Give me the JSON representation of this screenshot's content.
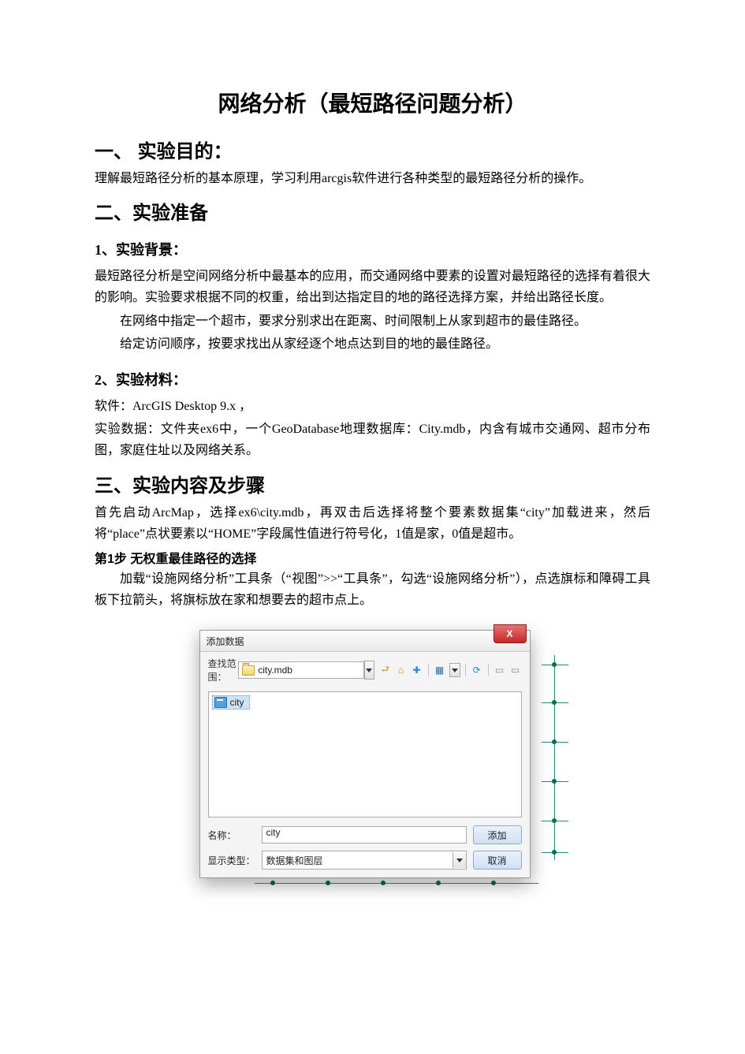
{
  "title": "网络分析（最短路径问题分析）",
  "sec1": {
    "heading": "一、 实验目的：",
    "p1": "理解最短路径分析的基本原理，学习利用arcgis软件进行各种类型的最短路径分析的操作。"
  },
  "sec2": {
    "heading": "二、实验准备",
    "sub1": {
      "heading": "1、实验背景：",
      "p1": "最短路径分析是空间网络分析中最基本的应用，而交通网络中要素的设置对最短路径的选择有着很大的影响。实验要求根据不同的权重，给出到达指定目的地的路径选择方案，并给出路径长度。",
      "p2": "在网络中指定一个超市，要求分别求出在距离、时间限制上从家到超市的最佳路径。",
      "p3": "给定访问顺序，按要求找出从家经逐个地点达到目的地的最佳路径。"
    },
    "sub2": {
      "heading": "2、实验材料：",
      "p1": "软件：ArcGIS Desktop 9.x ，",
      "p2": "实验数据：文件夹ex6中，一个GeoDatabase地理数据库：City.mdb，内含有城市交通网、超市分布图，家庭住址以及网络关系。"
    }
  },
  "sec3": {
    "heading": "三、实验内容及步骤",
    "p1": "首先启动ArcMap，选择ex6\\city.mdb，再双击后选择将整个要素数据集“city”加载进来，然后将“place”点状要素以“HOME”字段属性值进行符号化，1值是家，0值是超市。",
    "step1_head": "第1步 无权重最佳路径的选择",
    "step1_p": "加载“设施网络分析”工具条（“视图”>>“工具条”，勾选“设施网络分析”），点选旗标和障碍工具板下拉箭头，将旗标放在家和想要去的超市点上。"
  },
  "dialog": {
    "title": "添加数据",
    "close": "X",
    "lookin_label": "查找范围：",
    "lookin_value": "city.mdb",
    "item": "city",
    "name_label": "名称：",
    "name_value": "city",
    "type_label": "显示类型：",
    "type_value": "数据集和图层",
    "btn_add": "添加",
    "btn_cancel": "取消"
  }
}
